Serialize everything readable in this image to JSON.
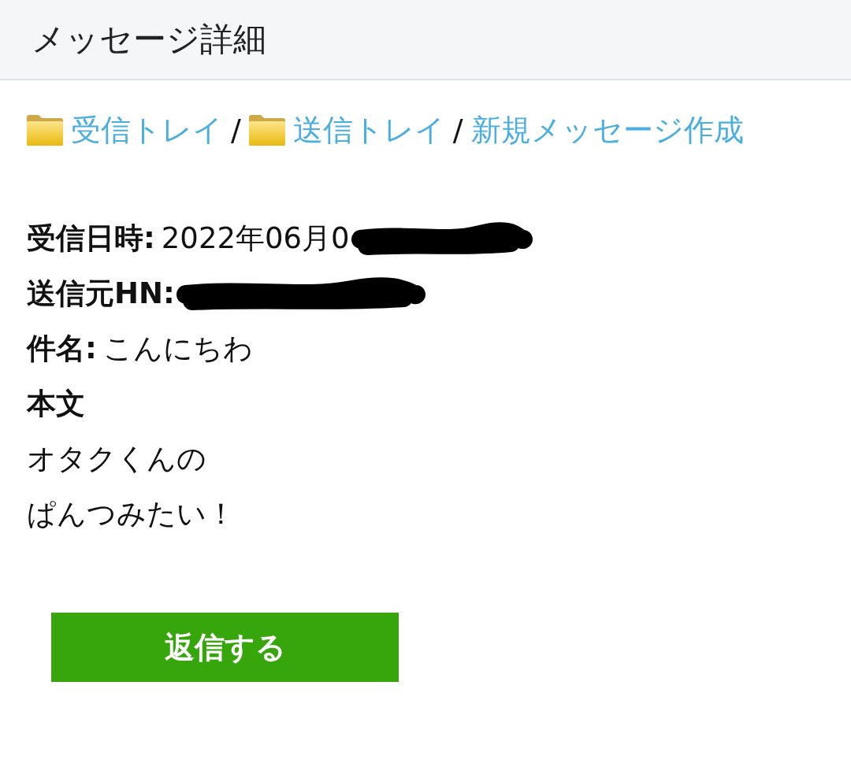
{
  "header": {
    "title": "メッセージ詳細"
  },
  "breadcrumb": [
    {
      "kind": "folder",
      "label": "受信トレイ"
    },
    {
      "kind": "separator",
      "label": "/"
    },
    {
      "kind": "folder",
      "label": "送信トレイ"
    },
    {
      "kind": "separator",
      "label": "/"
    },
    {
      "kind": "link",
      "label": "新規メッセージ作成"
    }
  ],
  "fields": [
    {
      "label": "受信日時:",
      "value": "2022年06月0",
      "redacted": true
    },
    {
      "label": "送信元HN:",
      "redacted": true
    },
    {
      "label": "件名:",
      "value": "こんにちわ"
    }
  ],
  "body": {
    "label": "本文",
    "lines": [
      "オタクくんの",
      "ぱんつみたい！"
    ]
  },
  "reply_button": {
    "label": "返信する"
  }
}
